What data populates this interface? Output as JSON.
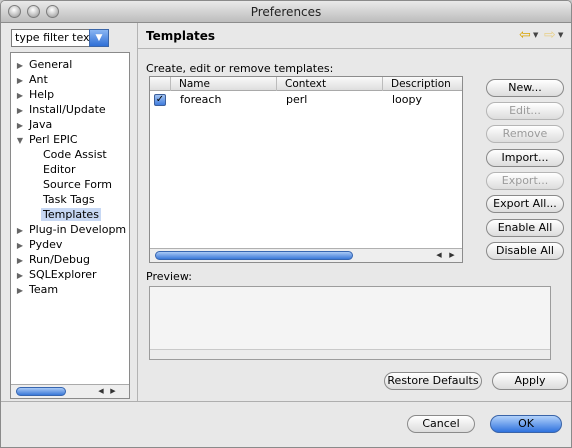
{
  "window": {
    "title": "Preferences"
  },
  "filter": {
    "value": "type filter text"
  },
  "tree": {
    "items": [
      {
        "label": "General",
        "expanded": false,
        "level": 0
      },
      {
        "label": "Ant",
        "expanded": false,
        "level": 0
      },
      {
        "label": "Help",
        "expanded": false,
        "level": 0
      },
      {
        "label": "Install/Update",
        "expanded": false,
        "level": 0
      },
      {
        "label": "Java",
        "expanded": false,
        "level": 0
      },
      {
        "label": "Perl EPIC",
        "expanded": true,
        "level": 0
      },
      {
        "label": "Code Assist",
        "level": 1
      },
      {
        "label": "Editor",
        "level": 1
      },
      {
        "label": "Source Form",
        "level": 1
      },
      {
        "label": "Task Tags",
        "level": 1
      },
      {
        "label": "Templates",
        "level": 1,
        "selected": true
      },
      {
        "label": "Plug-in Developm",
        "expanded": false,
        "level": 0
      },
      {
        "label": "Pydev",
        "expanded": false,
        "level": 0
      },
      {
        "label": "Run/Debug",
        "expanded": false,
        "level": 0
      },
      {
        "label": "SQLExplorer",
        "expanded": false,
        "level": 0
      },
      {
        "label": "Team",
        "expanded": false,
        "level": 0
      }
    ]
  },
  "page": {
    "title": "Templates",
    "section_label": "Create, edit or remove templates:",
    "preview_label": "Preview:",
    "table": {
      "columns": [
        "Name",
        "Context",
        "Description"
      ],
      "rows": [
        {
          "checked": true,
          "name": "foreach",
          "context": "perl",
          "description": "loopy"
        }
      ]
    },
    "buttons": {
      "new": "New...",
      "edit": "Edit...",
      "remove": "Remove",
      "import": "Import...",
      "export": "Export...",
      "export_all": "Export All...",
      "enable_all": "Enable All",
      "disable_all": "Disable All",
      "restore_defaults": "Restore Defaults",
      "apply": "Apply"
    }
  },
  "dialog": {
    "cancel": "Cancel",
    "ok": "OK"
  },
  "colors": {
    "accent": "#2f72de",
    "selection": "#c7d8f4",
    "nav_arrow": "#d9a300"
  }
}
